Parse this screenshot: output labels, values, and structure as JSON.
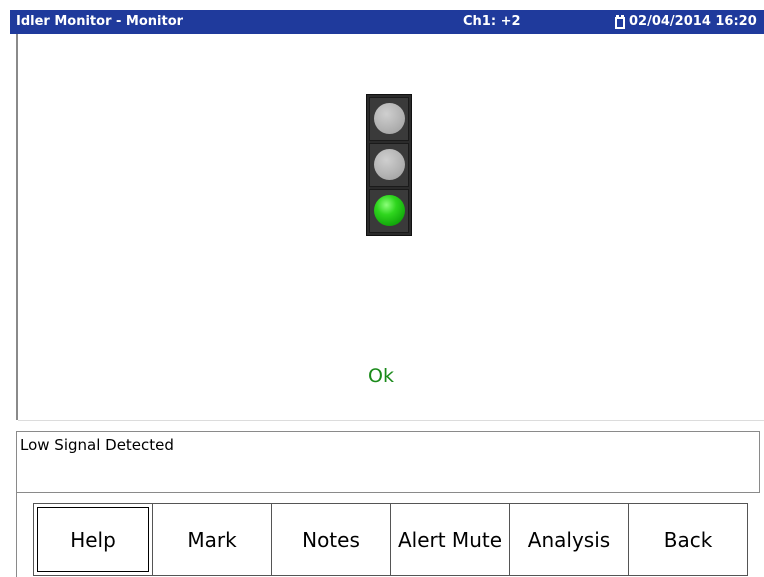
{
  "titlebar": {
    "title": "Idler Monitor - Monitor",
    "channel": "Ch1: +2",
    "datetime": "02/04/2014 16:20",
    "battery_icon": "battery-icon",
    "background_color": "#1f3a9c"
  },
  "monitor": {
    "traffic_light": {
      "lamps": [
        "off",
        "off",
        "green"
      ],
      "active_color": "#2fd61e"
    },
    "status_text": "Ok"
  },
  "message": {
    "text": "Low Signal Detected"
  },
  "buttons": [
    {
      "label": "Help"
    },
    {
      "label": "Mark"
    },
    {
      "label": "Notes"
    },
    {
      "label": "Alert Mute"
    },
    {
      "label": "Analysis"
    },
    {
      "label": "Back"
    }
  ]
}
